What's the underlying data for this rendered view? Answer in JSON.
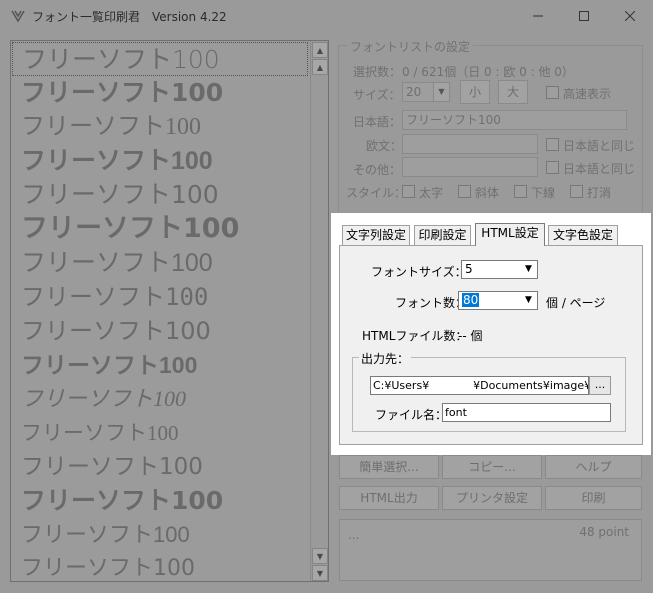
{
  "window": {
    "title": "フォント一覧印刷君　Version 4.22",
    "minimize_icon": "minimize-icon",
    "maximize_icon": "maximize-icon",
    "close_icon": "close-icon"
  },
  "preview": {
    "items": [
      "フリーソフト100",
      "フリーソフト100",
      "フリーソフト100",
      "フリーソフト100",
      "フリーソフト100",
      "フリーソフト100",
      "フリーソフト100",
      "フリーソフト100",
      "フリーソフト100",
      "フリーソフト100",
      "フリーソフト100",
      "フリーソフト100",
      "フリーソフト100",
      "フリーソフト100",
      "フリーソフト100",
      "フリーソフト100"
    ]
  },
  "font_list_settings": {
    "legend": "フォントリストの設定",
    "selection_label": "選択数：",
    "selection_value": "0 / 621個（日 0 : 欧 0 : 他 0）",
    "size_label": "サイズ：",
    "size_value": "20",
    "small_button": "小",
    "large_button": "大",
    "fast_display_label": "高速表示",
    "japanese_label": "日本語：",
    "japanese_value": "フリーソフト100",
    "western_label": "欧文：",
    "western_value": "",
    "same_as_japanese_1": "日本語と同じ",
    "other_label": "その他：",
    "other_value": "",
    "same_as_japanese_2": "日本語と同じ",
    "style_label": "スタイル：",
    "style_bold": "太字",
    "style_italic": "斜体",
    "style_underline": "下線",
    "style_strike": "打消"
  },
  "tabs": [
    "文字列設定",
    "印刷設定",
    "HTML設定",
    "文字色設定"
  ],
  "html_settings": {
    "font_size_label": "フォントサイズ：",
    "font_size_value": "5",
    "font_count_label": "フォント数：",
    "font_count_value": "80",
    "per_page_label": "個 / ページ",
    "html_files_label": "HTMLファイル数：",
    "html_files_value": "-- 個",
    "output_legend": "出力先：",
    "output_path": "C:¥Users¥　　　　¥Documents¥image¥html",
    "browse_label": "...",
    "file_name_label": "ファイル名：",
    "file_name_value": "font"
  },
  "bottom_buttons": {
    "simple_select": "簡単選択...",
    "copy": "コピー...",
    "help": "ヘルプ",
    "html_output": "HTML出力",
    "printer_settings": "プリンタ設定",
    "print": "印刷"
  },
  "status": {
    "left": "...",
    "size": "48 point"
  },
  "colors": {
    "dim_background": "#9a9a9a",
    "panel_face": "#f0f0f0",
    "selection": "#0078d7"
  }
}
